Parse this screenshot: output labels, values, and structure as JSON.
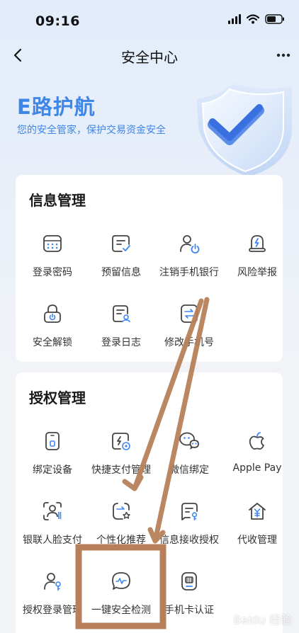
{
  "status_bar": {
    "time": "09:16"
  },
  "nav": {
    "title": "安全中心"
  },
  "hero": {
    "title": "E路护航",
    "subtitle": "您的安全管家，保护交易资金安全"
  },
  "info_section": {
    "title": "信息管理",
    "items": [
      {
        "label": "登录密码",
        "icon": "password-keypad-icon"
      },
      {
        "label": "预留信息",
        "icon": "reserved-info-icon"
      },
      {
        "label": "注销手机银行",
        "icon": "user-power-icon"
      },
      {
        "label": "风险举报",
        "icon": "risk-alert-icon"
      },
      {
        "label": "安全解锁",
        "icon": "unlock-icon"
      },
      {
        "label": "登录日志",
        "icon": "login-log-icon"
      },
      {
        "label": "修改手机号",
        "icon": "change-phone-icon"
      }
    ]
  },
  "auth_section": {
    "title": "授权管理",
    "items": [
      {
        "label": "绑定设备",
        "icon": "device-bind-icon"
      },
      {
        "label": "快捷支付管理",
        "icon": "quick-pay-icon"
      },
      {
        "label": "微信绑定",
        "icon": "wechat-icon"
      },
      {
        "label": "Apple Pay",
        "icon": "apple-icon"
      },
      {
        "label": "银联人脸支付",
        "icon": "face-pay-icon"
      },
      {
        "label": "个性化推荐",
        "icon": "recommend-icon"
      },
      {
        "label": "信息接收授权",
        "icon": "message-auth-icon"
      },
      {
        "label": "代收管理",
        "icon": "collection-icon"
      },
      {
        "label": "授权登录管理",
        "icon": "login-auth-icon"
      },
      {
        "label": "一键安全检测",
        "icon": "security-scan-icon"
      },
      {
        "label": "手机卡认证",
        "icon": "sim-card-icon"
      }
    ]
  },
  "watermark": "Baidu 经验",
  "colors": {
    "accent": "#3e86e8",
    "annotation": "#b8805a",
    "icon_stroke": "#444444",
    "icon_accent": "#3f87f0"
  }
}
